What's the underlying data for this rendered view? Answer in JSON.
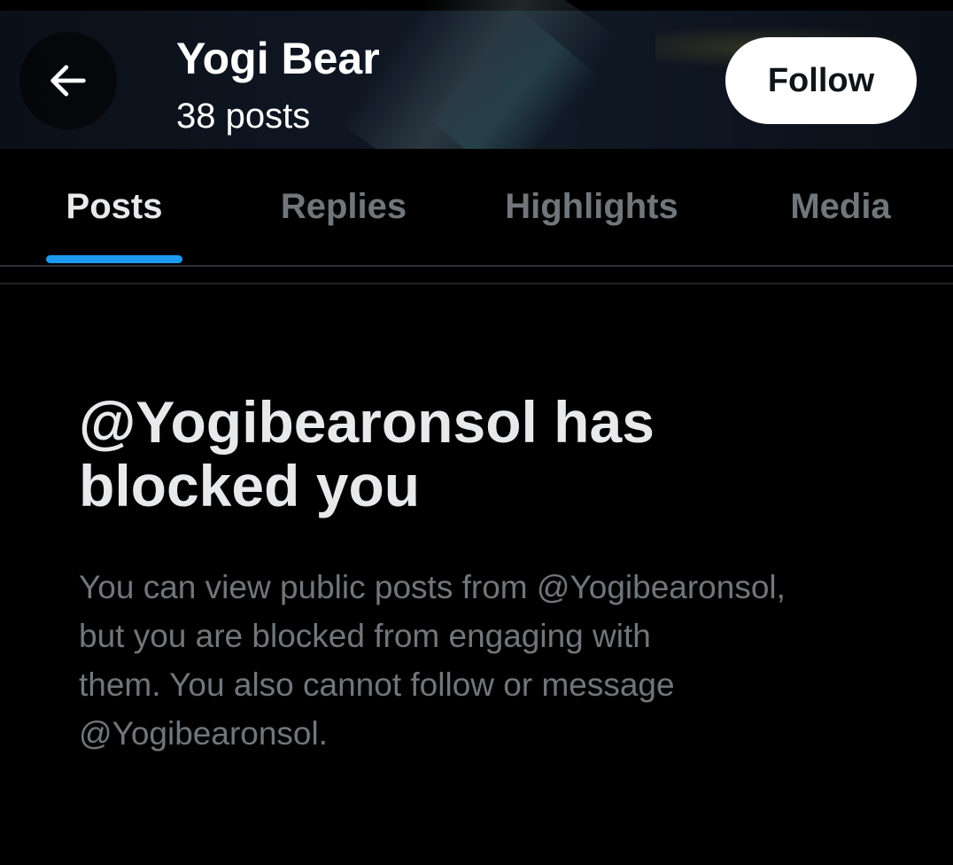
{
  "header": {
    "profile_name": "Yogi Bear",
    "post_count": "38 posts",
    "follow_label": "Follow",
    "back_icon": "arrow-left-icon"
  },
  "tabs": [
    {
      "label": "Posts",
      "active": true
    },
    {
      "label": "Replies",
      "active": false
    },
    {
      "label": "Highlights",
      "active": false
    },
    {
      "label": "Media",
      "active": false
    }
  ],
  "blocked": {
    "title_line1": "@Yogibearonsol has",
    "title_line2": "blocked you",
    "body_line1": "You can view public posts from @Yogibearonsol,",
    "body_line2": "but you are blocked from engaging with",
    "body_line3": "them. You also cannot follow or message",
    "body_line4": "@Yogibearonsol."
  },
  "colors": {
    "accent": "#1d9bf0",
    "background": "#000000",
    "primary_text": "#e7e9ea",
    "secondary_text": "#71767b"
  }
}
